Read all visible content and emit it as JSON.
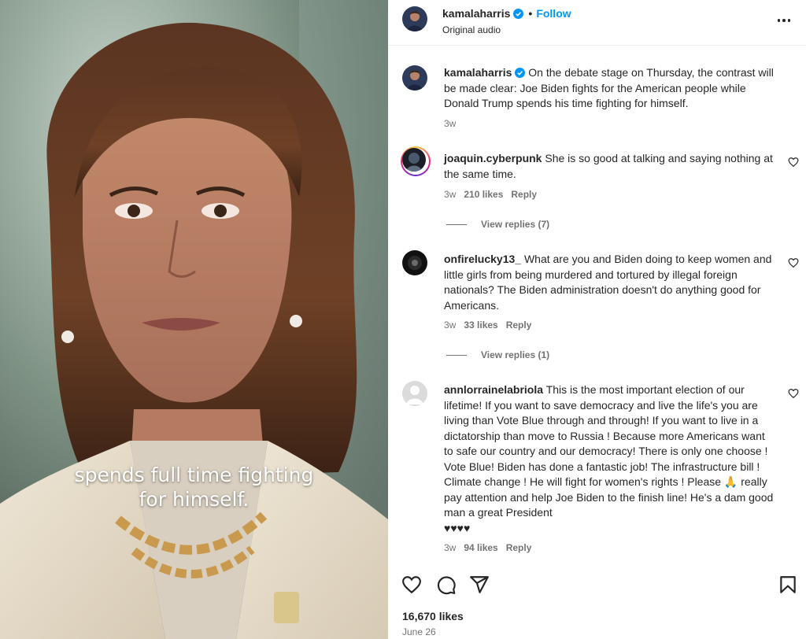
{
  "media": {
    "caption_lines": [
      "spends full time fighting",
      "for himself."
    ]
  },
  "header": {
    "username": "kamalaharris",
    "dot": "•",
    "follow_label": "Follow",
    "audio": "Original audio",
    "icons": [
      "avatar",
      "verified-badge-icon",
      "more-options-icon"
    ]
  },
  "caption": {
    "username": "kamalaharris",
    "text": "On the debate stage on Thursday, the contrast will be made clear: Joe Biden fights for the American people while Donald Trump spends his time fighting for himself.",
    "time": "3w"
  },
  "comments": [
    {
      "username": "joaquin.cyberpunk",
      "text": "She is so good at talking and saying nothing at the same time.",
      "time": "3w",
      "likes": "210 likes",
      "reply": "Reply",
      "view_replies": "View replies (7)"
    },
    {
      "username": "onfirelucky13_",
      "text": "What are you and Biden doing to keep women and little girls from being murdered and tortured by illegal foreign nationals? The Biden administration doesn't do anything good for Americans.",
      "time": "3w",
      "likes": "33 likes",
      "reply": "Reply",
      "view_replies": "View replies (1)"
    },
    {
      "username": "annlorrainelabriola",
      "text": "This is the most important election of our lifetime! If you want to save democracy and live the life's you are living than Vote Blue through and through! If you want to live in a dictatorship than move to Russia ! Because more Americans want to safe our country and our democracy! There is only one choose ! Vote Blue! Biden has done a fantastic job! The infrastructure bill ! Climate change ! He will fight for women's rights ! Please 🙏 really pay attention and help Joe Biden to the finish line! He's a dam good man a great President",
      "hearts": "♥♥♥♥",
      "time": "3w",
      "likes": "94 likes",
      "reply": "Reply"
    }
  ],
  "footer": {
    "likes_total": "16,670 likes",
    "date": "June 26",
    "icons": [
      "heart-icon",
      "comment-icon",
      "share-icon",
      "bookmark-icon"
    ]
  },
  "colors": {
    "accent": "#0095f6",
    "text": "#262626",
    "muted": "#737373"
  }
}
